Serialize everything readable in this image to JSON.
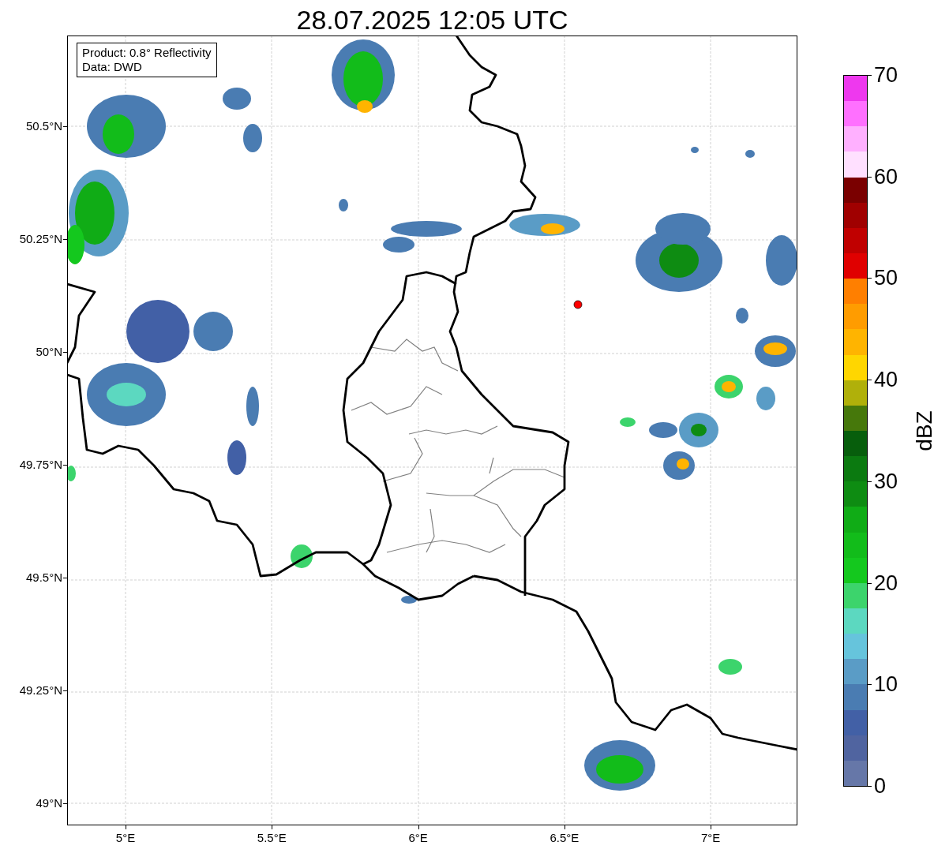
{
  "title": "28.07.2025 12:05 UTC",
  "legend": [
    "Product: 0.8° Reflectivity",
    "Data: DWD"
  ],
  "lat_ticks": [
    "50.5°N",
    "50.25°N",
    "50°N",
    "49.75°N",
    "49.5°N",
    "49.25°N",
    "49°N"
  ],
  "lon_ticks": [
    "5°E",
    "5.5°E",
    "6°E",
    "6.5°E",
    "7°E"
  ],
  "colorbar": {
    "label": "dBZ",
    "ticks": [
      "70",
      "60",
      "50",
      "40",
      "30",
      "20",
      "10",
      "0"
    ],
    "segments": [
      {
        "color": "#ee38ee"
      },
      {
        "color": "#ff70ff"
      },
      {
        "color": "#ffb0ff"
      },
      {
        "color": "#ffe0ff"
      },
      {
        "color": "#7a0000"
      },
      {
        "color": "#a00000"
      },
      {
        "color": "#c00000"
      },
      {
        "color": "#e00000"
      },
      {
        "color": "#ff7f00"
      },
      {
        "color": "#ff9c00"
      },
      {
        "color": "#ffb400"
      },
      {
        "color": "#ffd600"
      },
      {
        "color": "#b0b00a"
      },
      {
        "color": "#46780b"
      },
      {
        "color": "#075e0c"
      },
      {
        "color": "#0b7a10"
      },
      {
        "color": "#0e8c12"
      },
      {
        "color": "#10ac16"
      },
      {
        "color": "#12bc1a"
      },
      {
        "color": "#14c81e"
      },
      {
        "color": "#3cd46c"
      },
      {
        "color": "#5cd8c0"
      },
      {
        "color": "#66c4dc"
      },
      {
        "color": "#5a9cc6"
      },
      {
        "color": "#4a7cb2"
      },
      {
        "color": "#4260a6"
      },
      {
        "color": "#5064a0"
      },
      {
        "color": "#6677a8"
      }
    ]
  }
}
